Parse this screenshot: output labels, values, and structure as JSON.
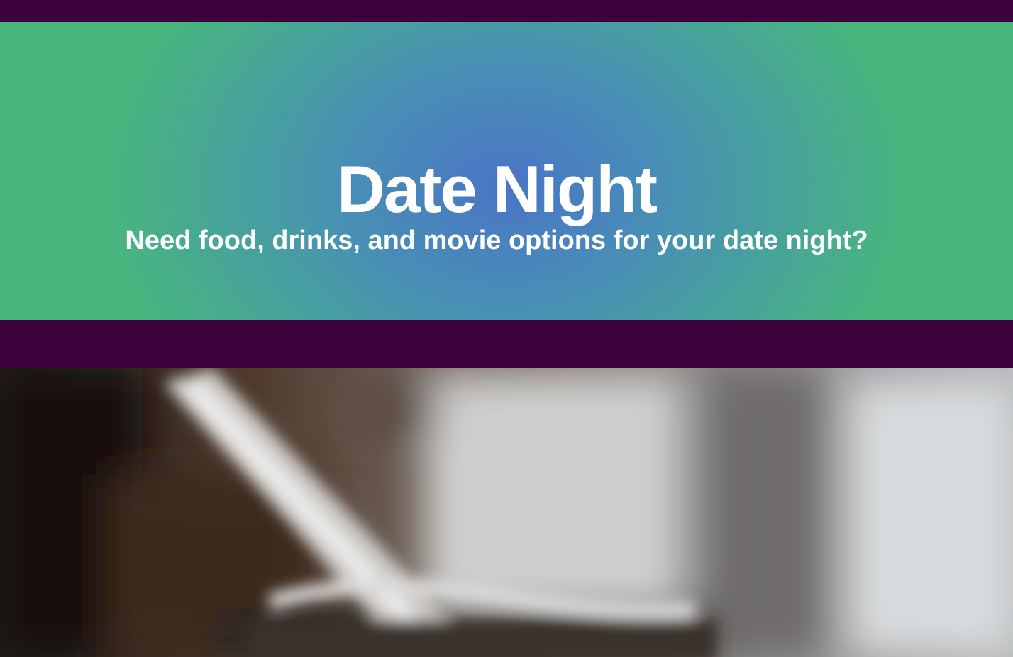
{
  "header": {
    "title": "Date Night",
    "subtitle": "Need food, drinks, and movie options for your date night?"
  },
  "colors": {
    "band": "#3c003b",
    "hero_center": "#4a74c6",
    "hero_edge": "#48b57f",
    "text": "#ffffff"
  },
  "photo": {
    "description_icon": "blurred-photo"
  }
}
